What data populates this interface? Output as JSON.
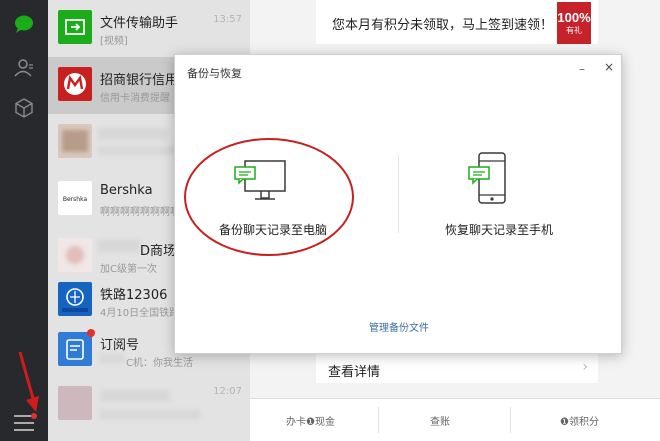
{
  "sidebar": {
    "icons": [
      "chat-bubble-icon",
      "contacts-icon",
      "favorites-cube-icon",
      "menu-icon"
    ],
    "accent": "#1aad19"
  },
  "chats": [
    {
      "name": "文件传输助手",
      "preview": "[视频]",
      "time": "13:57"
    },
    {
      "name": "招商银行信用卡",
      "preview": "信用卡消费提醒",
      "time": ""
    },
    {
      "name": "",
      "preview": "",
      "time": ""
    },
    {
      "name": "Bershka",
      "preview": "啊啊啊啊啊啊啊啊啊",
      "time": ""
    },
    {
      "name": "D商场",
      "preview": "加C级第一次",
      "time": ""
    },
    {
      "name": "铁路12306",
      "preview": "4月10日全国铁路",
      "time": ""
    },
    {
      "name": "订阅号",
      "preview": "C机：你我生活",
      "time": ""
    },
    {
      "name": "",
      "preview": "",
      "time": "12:07"
    }
  ],
  "content": {
    "banner_text": "您本月有积分未领取，马上签到速领！",
    "coupon_percent": "100%",
    "coupon_gift": "有礼",
    "details_label": "查看详情",
    "details_arrow": "›",
    "bottom_items": [
      "办卡❶现金",
      "查账",
      "❶领积分"
    ]
  },
  "dialog": {
    "title": "备份与恢复",
    "minimize": "–",
    "close": "×",
    "backup_label": "备份聊天记录至电脑",
    "restore_label": "恢复聊天记录至手机",
    "manage_link": "管理备份文件"
  },
  "colors": {
    "sidebar_bg": "#28292c",
    "highlight_red": "#c8201e",
    "wechat_green": "#1aad19",
    "cmb_red": "#c8201e",
    "link_blue": "#3a6ea5"
  }
}
